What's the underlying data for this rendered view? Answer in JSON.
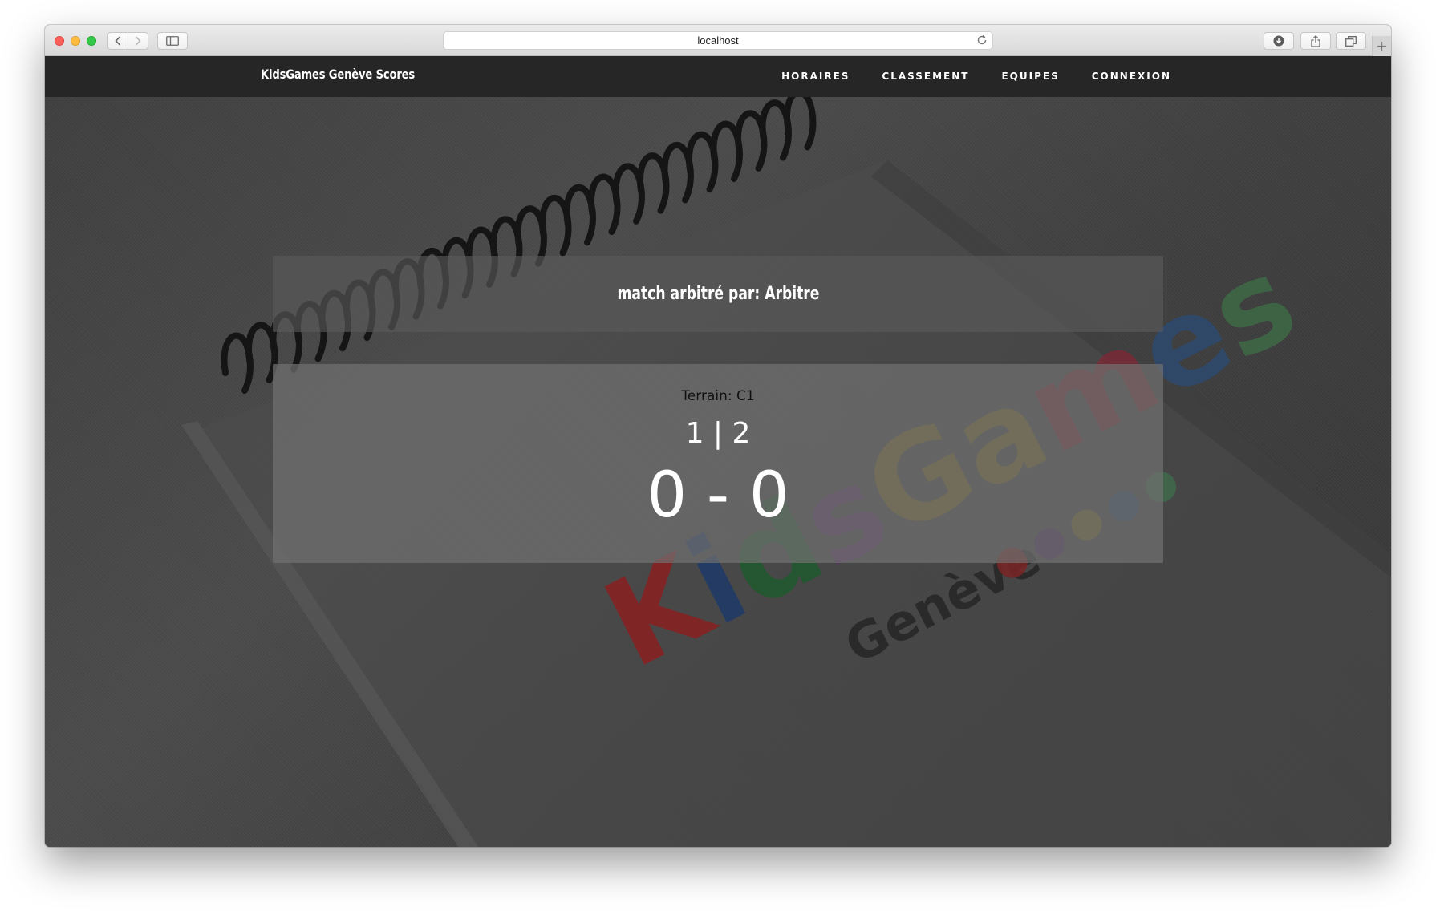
{
  "browser": {
    "url": "localhost"
  },
  "navbar": {
    "brand": "KidsGames Genève Scores",
    "links": [
      {
        "label": "HORAIRES"
      },
      {
        "label": "CLASSEMENT"
      },
      {
        "label": "EQUIPES"
      },
      {
        "label": "CONNEXION"
      }
    ]
  },
  "match": {
    "referee_text": "match arbitré par: Arbitre",
    "terrain": "Terrain: C1",
    "teams": "1 | 2",
    "score": "0 - 0"
  },
  "background_logo": {
    "text": "KidsGames",
    "subtext": "Genève",
    "letter_colors": [
      "#8a2020",
      "#1e3a68",
      "#1f5a2e",
      "#5a2f6a",
      "#7a6a1c",
      "#7a6a1c",
      "#7a2a36",
      "#2e4a70",
      "#3e6a46"
    ],
    "dot_colors": [
      "#7a2424",
      "#4a2a5a",
      "#7a6a2a",
      "#2e4a6a",
      "#3e6a4a"
    ]
  }
}
